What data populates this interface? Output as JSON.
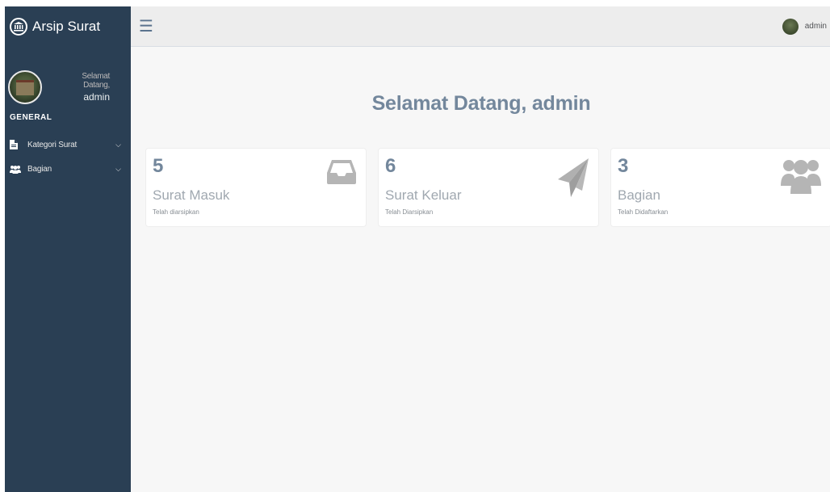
{
  "sidebar": {
    "brand": "Arsip Surat",
    "brand_icon": "bank-icon",
    "profile": {
      "welcome": "Selamat Datang,",
      "name": "admin"
    },
    "section_title": "GENERAL",
    "items": [
      {
        "label": "Kategori Surat",
        "icon": "file-icon"
      },
      {
        "label": "Bagian",
        "icon": "users-icon"
      }
    ]
  },
  "topbar": {
    "user": "admin",
    "menu_icon": "hamburger-icon"
  },
  "main": {
    "heading": "Selamat Datang, admin",
    "tiles": [
      {
        "count": "5",
        "title": "Surat Masuk",
        "subtitle": "Telah diarsipkan",
        "icon": "inbox-icon"
      },
      {
        "count": "6",
        "title": "Surat Keluar",
        "subtitle": "Telah Diarsipkan",
        "icon": "paper-plane-icon"
      },
      {
        "count": "3",
        "title": "Bagian",
        "subtitle": "Telah Didaftarkan",
        "icon": "users-icon"
      }
    ]
  },
  "colors": {
    "sidebar_bg": "#2a3f54",
    "heading": "#73879c",
    "icon_gray": "#a9a9a9"
  }
}
